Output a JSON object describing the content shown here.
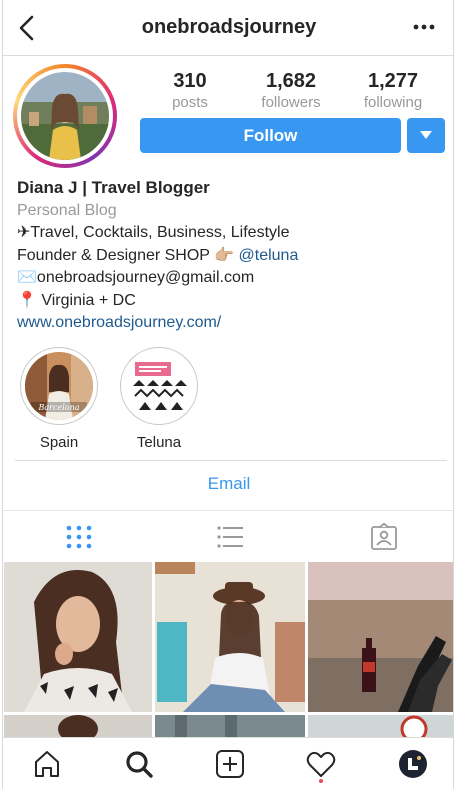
{
  "header": {
    "username": "onebroadsjourney",
    "back_icon": "back-chevron-icon",
    "more_icon": "more-dots-icon"
  },
  "stats": [
    {
      "value": "310",
      "label": "posts"
    },
    {
      "value": "1,682",
      "label": "followers"
    },
    {
      "value": "1,277",
      "label": "following"
    }
  ],
  "actions": {
    "follow_label": "Follow"
  },
  "bio": {
    "name": "Diana J | Travel Blogger",
    "category": "Personal Blog",
    "line1": "✈Travel, Cocktails, Business, Lifestyle",
    "line2_text": "Founder & Designer SHOP 👉🏼 ",
    "line2_mention": "@teluna",
    "line3": "✉️onebroadsjourney@gmail.com",
    "line4": "📍 Virginia + DC",
    "website": "www.onebroadsjourney.com/"
  },
  "highlights": [
    {
      "label": "Spain"
    },
    {
      "label": "Teluna"
    }
  ],
  "contact": {
    "email_label": "Email"
  },
  "colors": {
    "accent": "#3897f0",
    "link": "#1f5a8f",
    "muted": "#999999",
    "notification": "#ed4956"
  }
}
